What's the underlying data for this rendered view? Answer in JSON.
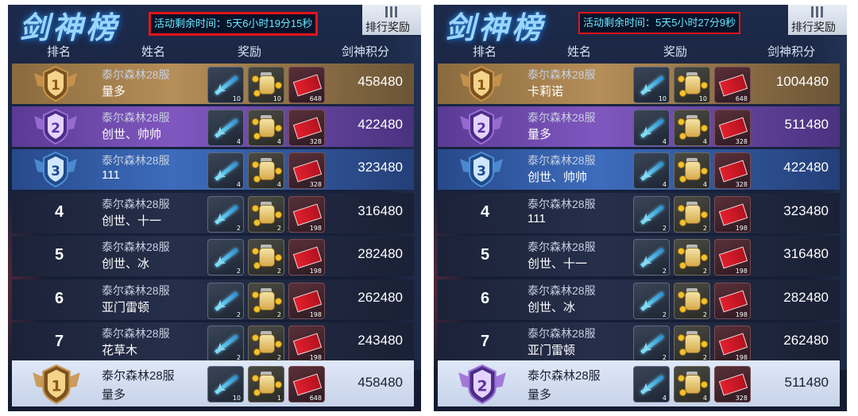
{
  "screens": [
    {
      "title": "剑神榜",
      "timer": "活动剩余时间：5天6小时19分15秒",
      "reward_button": "排行奖励",
      "headers": {
        "rank": "排名",
        "name": "姓名",
        "reward": "奖励",
        "score": "剑神积分"
      },
      "rows": [
        {
          "rank": "1",
          "server": "泰尔森林28服",
          "name": "量多",
          "score": "458480",
          "rewards": [
            "10",
            "10",
            "648"
          ]
        },
        {
          "rank": "2",
          "server": "泰尔森林28服",
          "name": "创世、帅帅",
          "score": "422480",
          "rewards": [
            "4",
            "4",
            "328"
          ]
        },
        {
          "rank": "3",
          "server": "泰尔森林28服",
          "name": "111",
          "score": "323480",
          "rewards": [
            "4",
            "4",
            "328"
          ]
        },
        {
          "rank": "4",
          "server": "泰尔森林28服",
          "name": "创世、十一",
          "score": "316480",
          "rewards": [
            "2",
            "2",
            "198"
          ]
        },
        {
          "rank": "5",
          "server": "泰尔森林28服",
          "name": "创世、冰",
          "score": "282480",
          "rewards": [
            "2",
            "2",
            "198"
          ]
        },
        {
          "rank": "6",
          "server": "泰尔森林28服",
          "name": "亚门雷顿",
          "score": "262480",
          "rewards": [
            "2",
            "2",
            "198"
          ]
        },
        {
          "rank": "7",
          "server": "泰尔森林28服",
          "name": "花草木",
          "score": "243480",
          "rewards": [
            "2",
            "2",
            "198"
          ]
        }
      ],
      "mine": {
        "rank": "1",
        "server": "泰尔森林28服",
        "name": "量多",
        "score": "458480",
        "rewards": [
          "10",
          "1",
          "648"
        ]
      }
    },
    {
      "title": "剑神榜",
      "timer": "活动剩余时间：5天5小时27分9秒",
      "reward_button": "排行奖励",
      "headers": {
        "rank": "排名",
        "name": "姓名",
        "reward": "奖励",
        "score": "剑神积分"
      },
      "rows": [
        {
          "rank": "1",
          "server": "泰尔森林28服",
          "name": "卡莉诺",
          "score": "1004480",
          "rewards": [
            "10",
            "10",
            "648"
          ]
        },
        {
          "rank": "2",
          "server": "泰尔森林28服",
          "name": "量多",
          "score": "511480",
          "rewards": [
            "4",
            "4",
            "328"
          ]
        },
        {
          "rank": "3",
          "server": "泰尔森林28服",
          "name": "创世、帅帅",
          "score": "422480",
          "rewards": [
            "4",
            "4",
            "328"
          ]
        },
        {
          "rank": "4",
          "server": "泰尔森林28服",
          "name": "111",
          "score": "323480",
          "rewards": [
            "2",
            "2",
            "198"
          ]
        },
        {
          "rank": "5",
          "server": "泰尔森林28服",
          "name": "创世、十一",
          "score": "316480",
          "rewards": [
            "2",
            "2",
            "198"
          ]
        },
        {
          "rank": "6",
          "server": "泰尔森林28服",
          "name": "创世、冰",
          "score": "282480",
          "rewards": [
            "2",
            "2",
            "198"
          ]
        },
        {
          "rank": "7",
          "server": "泰尔森林28服",
          "name": "亚门雷顿",
          "score": "262480",
          "rewards": [
            "2",
            "2",
            "198"
          ]
        }
      ],
      "mine": {
        "rank": "2",
        "server": "泰尔森林28服",
        "name": "量多",
        "score": "511480",
        "rewards": [
          "4",
          "4",
          "328"
        ]
      }
    }
  ],
  "colors": {
    "timer_border": "#e3141a",
    "timer_text": "#69e6ff",
    "gold_row": "#b58e58",
    "purple_row": "#8057bf",
    "blue_row": "#3d6cbc",
    "normal_row": "#262f4a",
    "my_row": "#dfe8f8"
  },
  "icons": [
    "trophy-badge-icon",
    "sword-icon",
    "gold-jar-icon",
    "red-ticket-icon",
    "reward-list-icon"
  ]
}
